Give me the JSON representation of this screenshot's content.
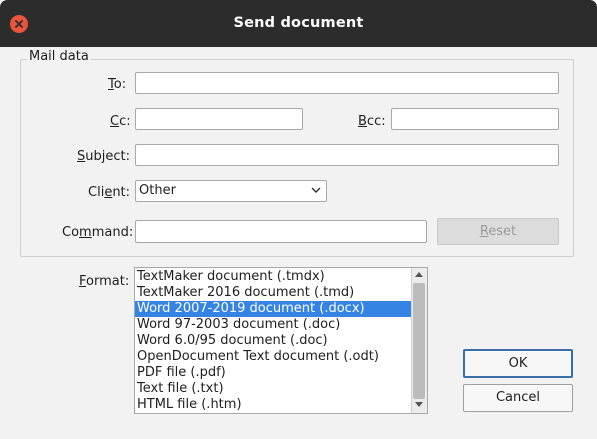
{
  "window": {
    "title": "Send document"
  },
  "mail_data": {
    "group_title": "Mail data",
    "to": {
      "label_mnemonic": "T",
      "label_rest": "o:",
      "value": ""
    },
    "cc": {
      "label_mnemonic": "C",
      "label_rest": "c:",
      "value": ""
    },
    "bcc": {
      "label_mnemonic": "B",
      "label_rest": "cc:",
      "value": ""
    },
    "subject": {
      "label_pre": "",
      "label_mnemonic": "S",
      "label_rest": "ubject:",
      "value": ""
    },
    "client": {
      "label_pre": "Cli",
      "label_mnemonic": "e",
      "label_rest": "nt:",
      "value": "Other"
    },
    "command": {
      "label_pre": "Co",
      "label_mnemonic": "m",
      "label_rest": "mand:",
      "value": ""
    },
    "reset_mnemonic": "R",
    "reset_rest": "eset"
  },
  "format": {
    "label_mnemonic": "F",
    "label_rest": "ormat:",
    "items": [
      "TextMaker document (.tmdx)",
      "TextMaker 2016 document (.tmd)",
      "Word 2007-2019 document (.docx)",
      "Word 97-2003 document (.doc)",
      "Word 6.0/95 document (.doc)",
      "OpenDocument Text document (.odt)",
      "PDF file (.pdf)",
      "Text file (.txt)",
      "HTML file (.htm)"
    ],
    "selected_index": 2
  },
  "buttons": {
    "ok": "OK",
    "cancel": "Cancel"
  },
  "colors": {
    "titlebar": "#2c2c2c",
    "close": "#e9543a",
    "selection": "#3584e4",
    "default_button_border": "#3a6ea8"
  },
  "icons": {
    "close": "close-icon",
    "combo": "chevron-down-icon",
    "scroll_up": "arrow-up-icon",
    "scroll_down": "arrow-down-icon"
  }
}
